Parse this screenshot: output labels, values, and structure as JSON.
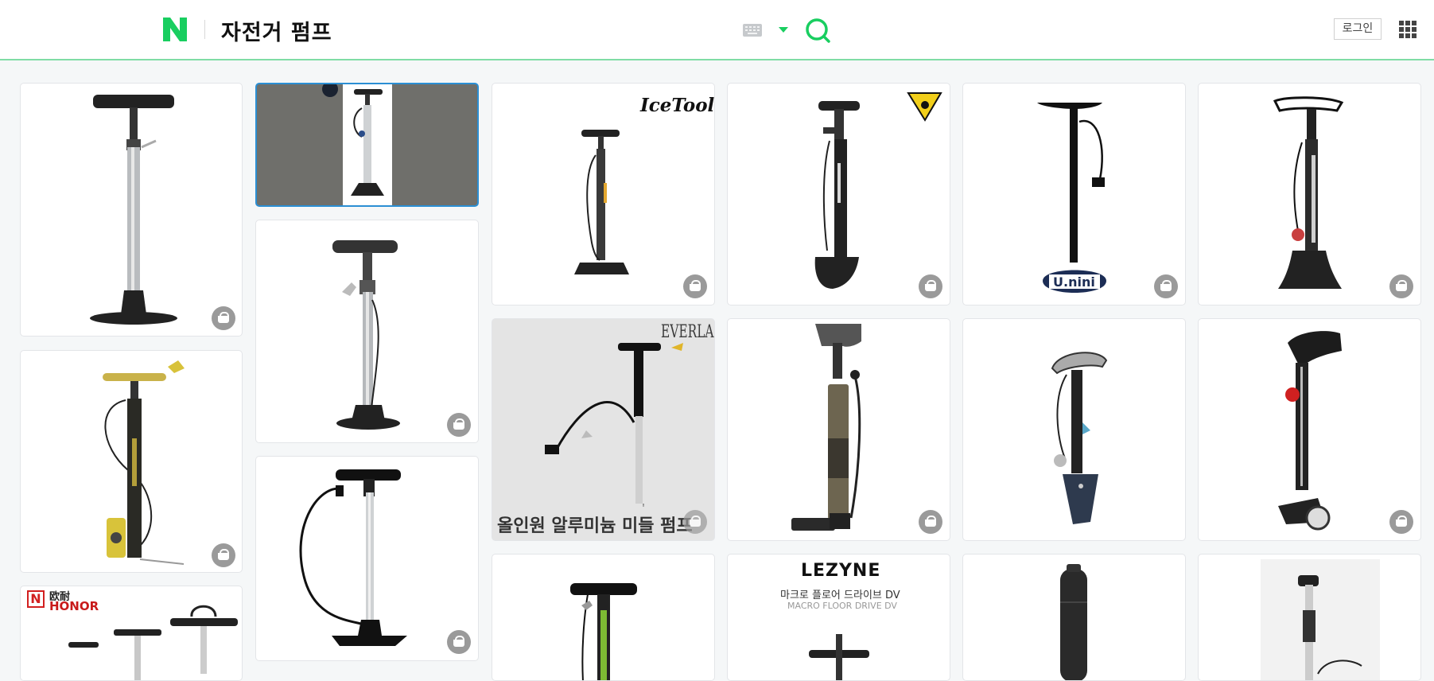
{
  "header": {
    "logo": "N",
    "query": "자전거 펌프",
    "login_label": "로그인"
  },
  "icons": {
    "keyboard": "keyboard-icon",
    "dropdown": "caret-down-icon",
    "search": "search-icon",
    "apps": "grid-menu-icon",
    "cart": "shopping-basket-icon"
  },
  "colors": {
    "brand_green": "#19ce60",
    "selected_border": "#2b8fd4"
  },
  "results": {
    "brands": {
      "icetoolz": "IceToolz",
      "topeak": "TOPEAK",
      "unini": "U.nini",
      "everlast": "EVERLAST",
      "lezyne": "LEZYNE",
      "honor": "HONOR",
      "honor_cn": "欧耐"
    },
    "captions": {
      "everlast_overlay": "올인원 알루미늄 미들 펌프",
      "lezyne_kr": "마크로 플로어 드라이브 DV",
      "lezyne_en": "MACRO FLOOR DRIVE DV"
    }
  }
}
